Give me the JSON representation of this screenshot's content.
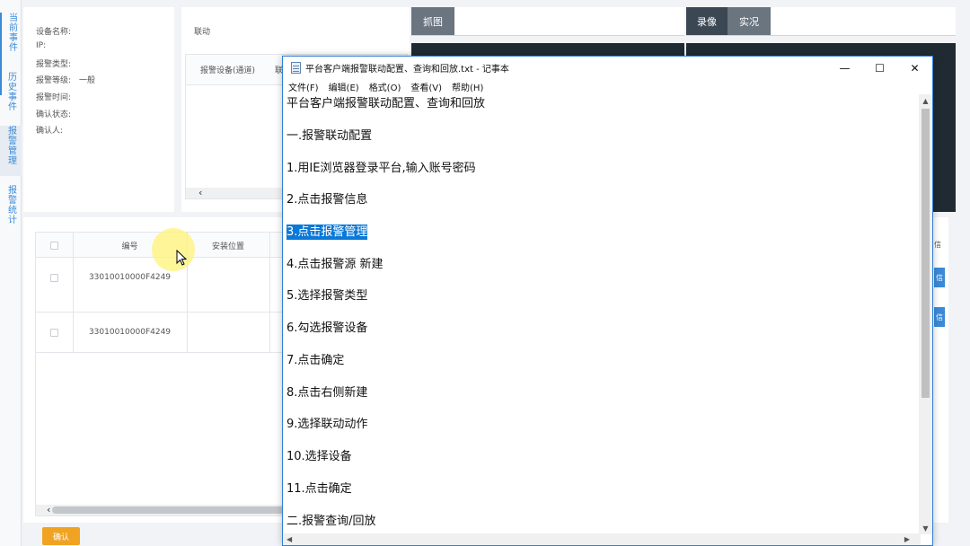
{
  "left_tabs": [
    "当前事件",
    "历史事件",
    "报警管理",
    "报警统计"
  ],
  "detail": {
    "fields": [
      {
        "label": "设备名称:",
        "value": ""
      },
      {
        "label": "IP:",
        "value": ""
      },
      {
        "label": "报警类型:",
        "value": ""
      },
      {
        "label": "报警等级:",
        "value": "一般"
      },
      {
        "label": "报警时间:",
        "value": ""
      },
      {
        "label": "确认状态:",
        "value": ""
      },
      {
        "label": "确认人:",
        "value": ""
      }
    ]
  },
  "linkage": {
    "title": "联动",
    "col1": "报警设备(通道)",
    "col2_partial": "联"
  },
  "capture_tab": "抓图",
  "video_tabs": [
    "录像",
    "实况"
  ],
  "list": {
    "columns": [
      "编号",
      "安装位置"
    ],
    "rows": [
      {
        "id": "33010010000F4249",
        "location": ""
      },
      {
        "id": "33010010000F4249",
        "location": ""
      }
    ],
    "right_col_partial": "信",
    "row_btn": "信"
  },
  "confirm_label": "确认",
  "notepad": {
    "title": "平台客户端报警联动配置、查询和回放.txt - 记事本",
    "menus": [
      "文件(F)",
      "编辑(E)",
      "格式(O)",
      "查看(V)",
      "帮助(H)"
    ],
    "lines": [
      "平台客户端报警联动配置、查询和回放",
      "一.报警联动配置",
      "1.用IE浏览器登录平台,输入账号密码",
      "2.点击报警信息",
      "3.点击报警管理",
      "4.点击报警源 新建",
      "5.选择报警类型",
      "6.勾选报警设备",
      "7.点击确定",
      "8.点击右侧新建",
      "9.选择联动动作",
      "10.选择设备",
      "11.点击确定",
      "二.报警查询/回放"
    ],
    "selected_line_index": 4,
    "window_buttons": [
      "—",
      "☐",
      "✕"
    ]
  }
}
